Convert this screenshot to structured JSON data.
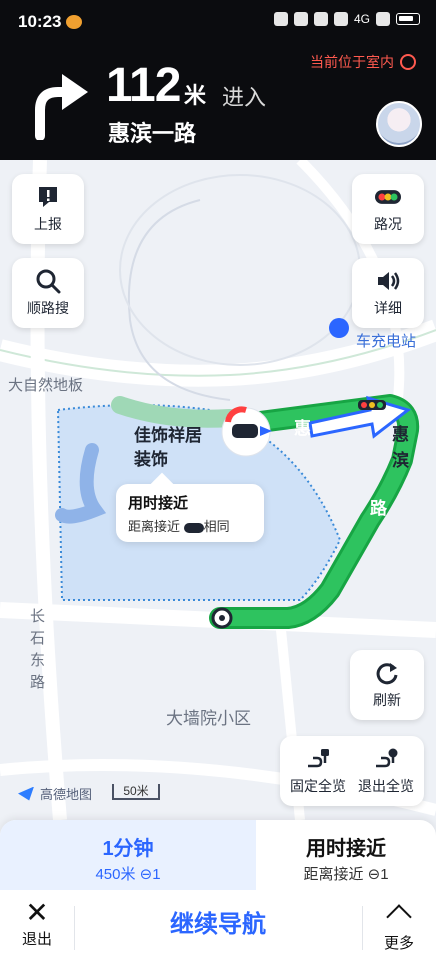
{
  "status_bar": {
    "time": "10:23",
    "network": "4G"
  },
  "header": {
    "distance": "112",
    "distance_unit": "米",
    "action": "进入",
    "road_name": "惠滨一路",
    "indoor_notice": "当前位于室内"
  },
  "map": {
    "poi_name_line1": "佳饰祥居",
    "poi_name_line2": "装饰",
    "labels": {
      "da_ziran": "大自然地板",
      "changshi_dong": [
        "长",
        "石",
        "东",
        "路"
      ],
      "daqiang": "大墙院小区",
      "charging": "车充电站",
      "road_text_1": "惠",
      "road_text_vertical": [
        "惠",
        "滨",
        "路"
      ]
    },
    "bubble": {
      "title": "用时接近",
      "subtitle_prefix": "距离接近",
      "subtitle_suffix": "相同"
    },
    "brand": "高德地图",
    "scale": "50米"
  },
  "buttons": {
    "report": "上报",
    "search_along": "顺路搜",
    "traffic": "路况",
    "detail": "详细",
    "refresh": "刷新",
    "fixed_overview": "固定全览",
    "exit_overview": "退出全览"
  },
  "routes": [
    {
      "time": "1分钟",
      "info": "450米 ⊖1",
      "selected": true
    },
    {
      "time": "用时接近",
      "info": "距离接近 ⊖1",
      "selected": false
    }
  ],
  "bottom_bar": {
    "exit": "退出",
    "continue": "继续导航",
    "more": "更多"
  },
  "colors": {
    "route_green": "#1fb24a",
    "accent_blue": "#2b66ff",
    "indoor_red": "#ff5a4f"
  }
}
